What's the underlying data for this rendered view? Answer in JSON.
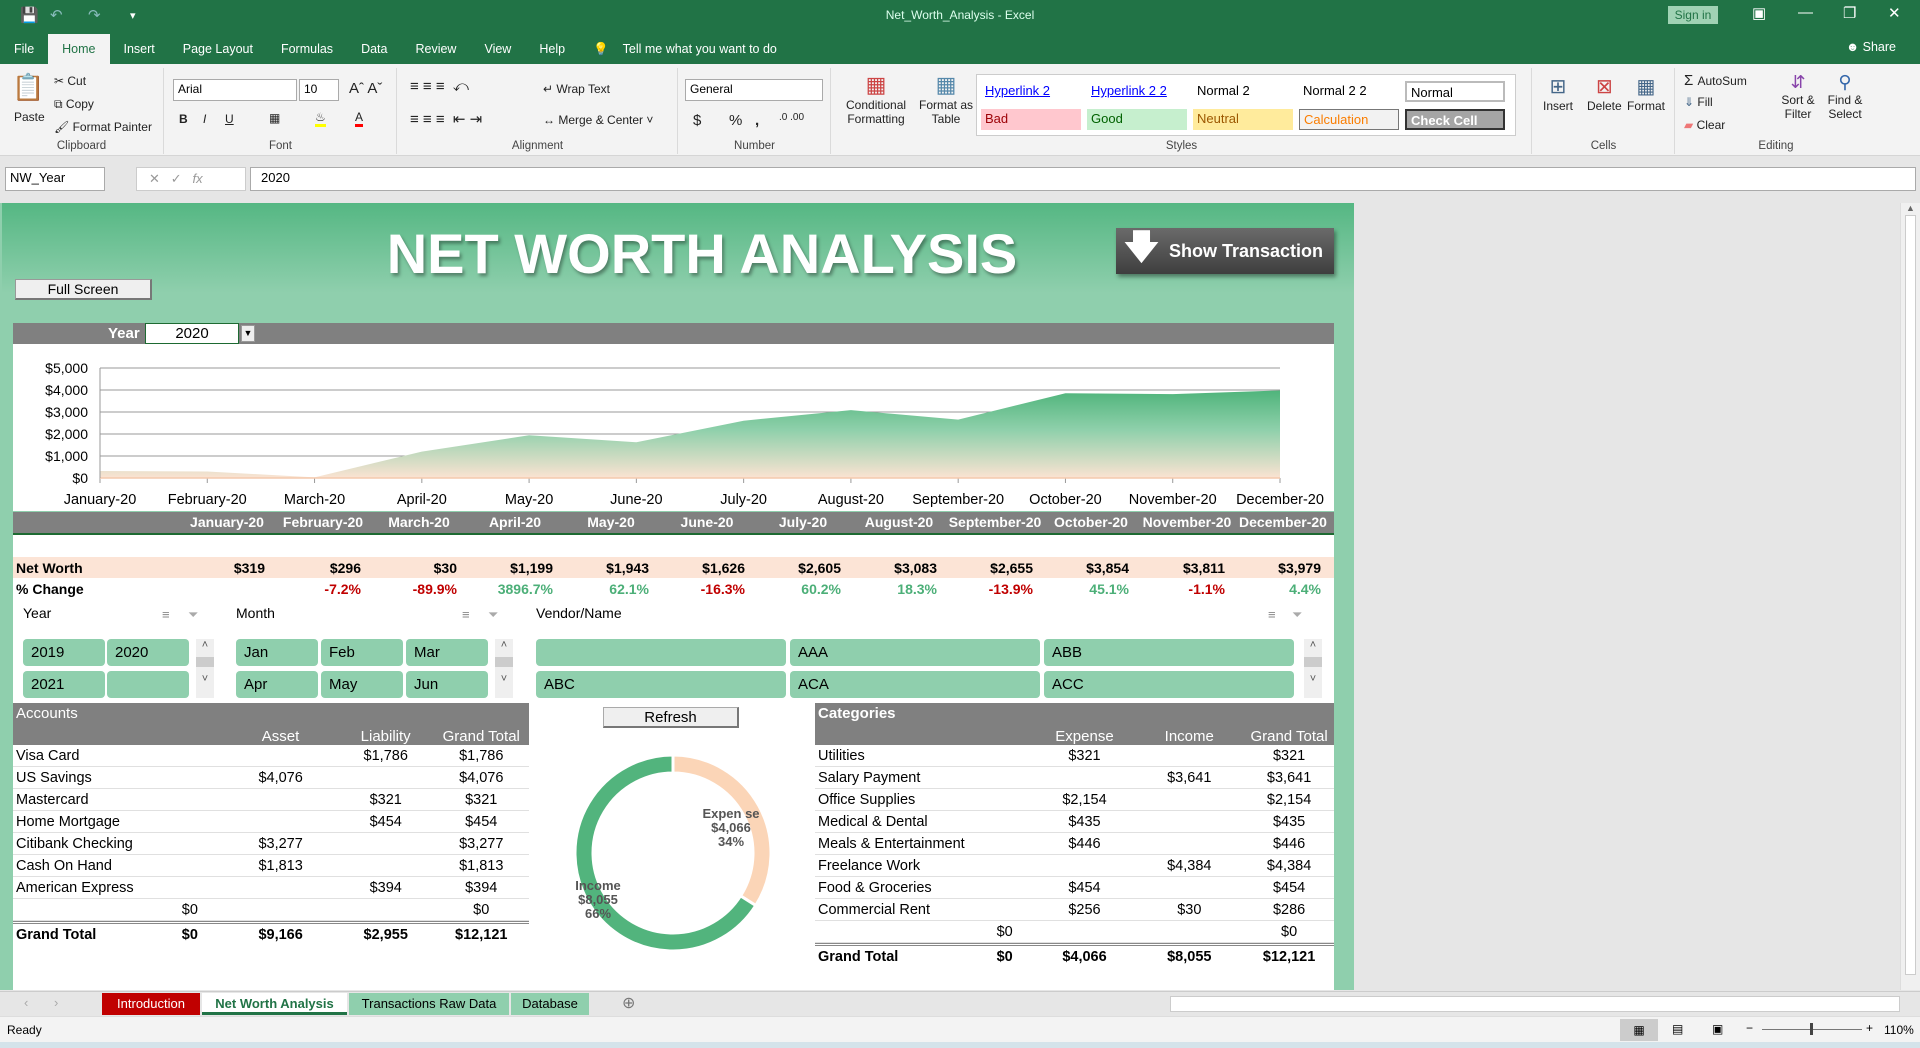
{
  "window": {
    "title": "Net_Worth_Analysis  -  Excel",
    "sign_in": "Sign in",
    "share": "Share"
  },
  "tabs": [
    "File",
    "Home",
    "Insert",
    "Page Layout",
    "Formulas",
    "Data",
    "Review",
    "View",
    "Help"
  ],
  "tell_me": "Tell me what you want to do",
  "ribbon": {
    "clipboard": {
      "label": "Clipboard",
      "paste": "Paste",
      "cut": "Cut",
      "copy": "Copy",
      "format_painter": "Format Painter"
    },
    "font": {
      "label": "Font",
      "name": "Arial",
      "size": "10",
      "bold": "B",
      "italic": "I",
      "underline": "U"
    },
    "alignment": {
      "label": "Alignment",
      "wrap": "Wrap Text",
      "merge": "Merge & Center"
    },
    "number": {
      "label": "Number",
      "format": "General",
      "currency": "$",
      "percent": "%",
      "comma": ","
    },
    "styles": {
      "label": "Styles",
      "conditional": "Conditional Formatting",
      "format_table": "Format as Table",
      "cells": [
        {
          "text": "Hyperlink 2",
          "color": "#0000ff",
          "bg": "#ffffff"
        },
        {
          "text": "Hyperlink 2 2",
          "color": "#0000ff",
          "bg": "#ffffff"
        },
        {
          "text": "Normal 2",
          "color": "#000000",
          "bg": "#ffffff"
        },
        {
          "text": "Normal 2 2",
          "color": "#000000",
          "bg": "#ffffff"
        },
        {
          "text": "Normal",
          "color": "#000000",
          "bg": "#ffffff"
        },
        {
          "text": "Bad",
          "color": "#9c0006",
          "bg": "#ffc7ce"
        },
        {
          "text": "Good",
          "color": "#006100",
          "bg": "#c6efce"
        },
        {
          "text": "Neutral",
          "color": "#9c5700",
          "bg": "#ffeb9c"
        },
        {
          "text": "Calculation",
          "color": "#fa7d00",
          "bg": "#f2f2f2"
        },
        {
          "text": "Check Cell",
          "color": "#ffffff",
          "bg": "#a5a5a5"
        }
      ]
    },
    "cells": {
      "label": "Cells",
      "insert": "Insert",
      "delete": "Delete",
      "format": "Format"
    },
    "editing": {
      "label": "Editing",
      "autosum": "AutoSum",
      "fill": "Fill",
      "clear": "Clear",
      "sort": "Sort & Filter",
      "find": "Find & Select"
    }
  },
  "formula_bar": {
    "name_box": "NW_Year",
    "value": "2020",
    "fx": "fx"
  },
  "dashboard": {
    "title": "NET WORTH ANALYSIS",
    "show_transaction": "Show Transaction",
    "full_screen": "Full Screen",
    "year_label": "Year",
    "year_value": "2020",
    "refresh": "Refresh"
  },
  "chart_data": {
    "type": "area",
    "categories": [
      "January-20",
      "February-20",
      "March-20",
      "April-20",
      "May-20",
      "June-20",
      "July-20",
      "August-20",
      "September-20",
      "October-20",
      "November-20",
      "December-20"
    ],
    "values": [
      319,
      296,
      30,
      1199,
      1943,
      1626,
      2605,
      3083,
      2655,
      3854,
      3811,
      3979
    ],
    "yticks": [
      "$0",
      "$1,000",
      "$2,000",
      "$3,000",
      "$4,000",
      "$5,000"
    ],
    "ylim": [
      0,
      5000
    ],
    "grid": true,
    "legend": "none",
    "colors": {
      "top": "#4fb47b",
      "bottom": "#fbe3d2"
    }
  },
  "monthly": {
    "months": [
      "January-20",
      "February-20",
      "March-20",
      "April-20",
      "May-20",
      "June-20",
      "July-20",
      "August-20",
      "September-20",
      "October-20",
      "November-20",
      "December-20"
    ],
    "net_worth_label": "Net Worth",
    "change_label": "% Change",
    "net_worth": [
      "$319",
      "$296",
      "$30",
      "$1,199",
      "$1,943",
      "$1,626",
      "$2,605",
      "$3,083",
      "$2,655",
      "$3,854",
      "$3,811",
      "$3,979"
    ],
    "change": [
      "",
      "-7.2%",
      "-89.9%",
      "3896.7%",
      "62.1%",
      "-16.3%",
      "60.2%",
      "18.3%",
      "-13.9%",
      "45.1%",
      "-1.1%",
      "4.4%"
    ],
    "pos_color": "#4caf78",
    "neg_color": "#c00000"
  },
  "slicers": {
    "year": {
      "title": "Year",
      "items": [
        "2019",
        "2020",
        "2021",
        ""
      ]
    },
    "month": {
      "title": "Month",
      "items": [
        "Jan",
        "Feb",
        "Mar",
        "Apr",
        "May",
        "Jun"
      ]
    },
    "vendor": {
      "title": "Vendor/Name",
      "items": [
        "",
        "AAA",
        "ABB",
        "ABC",
        "ACA",
        "ACC"
      ]
    }
  },
  "accounts": {
    "title": "Accounts",
    "columns": [
      "Asset",
      "Liability",
      "Grand Total"
    ],
    "rows": [
      [
        "Visa Card",
        "",
        "",
        "$1,786",
        "$1,786"
      ],
      [
        "US Savings",
        "",
        "$4,076",
        "",
        "$4,076"
      ],
      [
        "Mastercard",
        "",
        "",
        "$321",
        "$321"
      ],
      [
        "Home Mortgage",
        "",
        "",
        "$454",
        "$454"
      ],
      [
        "Citibank Checking",
        "",
        "$3,277",
        "",
        "$3,277"
      ],
      [
        "Cash On Hand",
        "",
        "$1,813",
        "",
        "$1,813"
      ],
      [
        "American Express",
        "",
        "",
        "$394",
        "$394"
      ],
      [
        "",
        "$0",
        "",
        "",
        "$0"
      ]
    ],
    "total": [
      "Grand Total",
      "$0",
      "$9,166",
      "$2,955",
      "$12,121"
    ]
  },
  "donut": {
    "slices": [
      {
        "name": "Expense",
        "label": "Expen se",
        "value": "$4,066",
        "pct": "34%",
        "frac": 0.34,
        "color": "#fbd5b7"
      },
      {
        "name": "Income",
        "label": "Income",
        "value": "$8,055",
        "pct": "66%",
        "frac": 0.66,
        "color": "#52b47d"
      }
    ]
  },
  "categories": {
    "title": "Categories",
    "columns": [
      "Expense",
      "Income",
      "Grand Total"
    ],
    "rows": [
      [
        "Utilities",
        "",
        "$321",
        "",
        "$321"
      ],
      [
        "Salary Payment",
        "",
        "",
        "$3,641",
        "$3,641"
      ],
      [
        "Office Supplies",
        "",
        "$2,154",
        "",
        "$2,154"
      ],
      [
        "Medical & Dental",
        "",
        "$435",
        "",
        "$435"
      ],
      [
        "Meals & Entertainment",
        "",
        "$446",
        "",
        "$446"
      ],
      [
        "Freelance Work",
        "",
        "",
        "$4,384",
        "$4,384"
      ],
      [
        "Food & Groceries",
        "",
        "$454",
        "",
        "$454"
      ],
      [
        "Commercial Rent",
        "",
        "$256",
        "$30",
        "$286"
      ],
      [
        "",
        "$0",
        "",
        "",
        "$0"
      ]
    ],
    "total": [
      "Grand Total",
      "$0",
      "$4,066",
      "$8,055",
      "$12,121"
    ]
  },
  "sheet_tabs": [
    {
      "label": "Introduction",
      "bg": "#c00000",
      "color": "#ffffff"
    },
    {
      "label": "Net Worth Analysis",
      "bg": "#ffffff",
      "color": "#217346"
    },
    {
      "label": "Transactions Raw Data",
      "bg": "#8fcfad",
      "color": "#000000"
    },
    {
      "label": "Database",
      "bg": "#8fcfad",
      "color": "#000000"
    }
  ],
  "status": {
    "ready": "Ready",
    "zoom": "110%"
  }
}
